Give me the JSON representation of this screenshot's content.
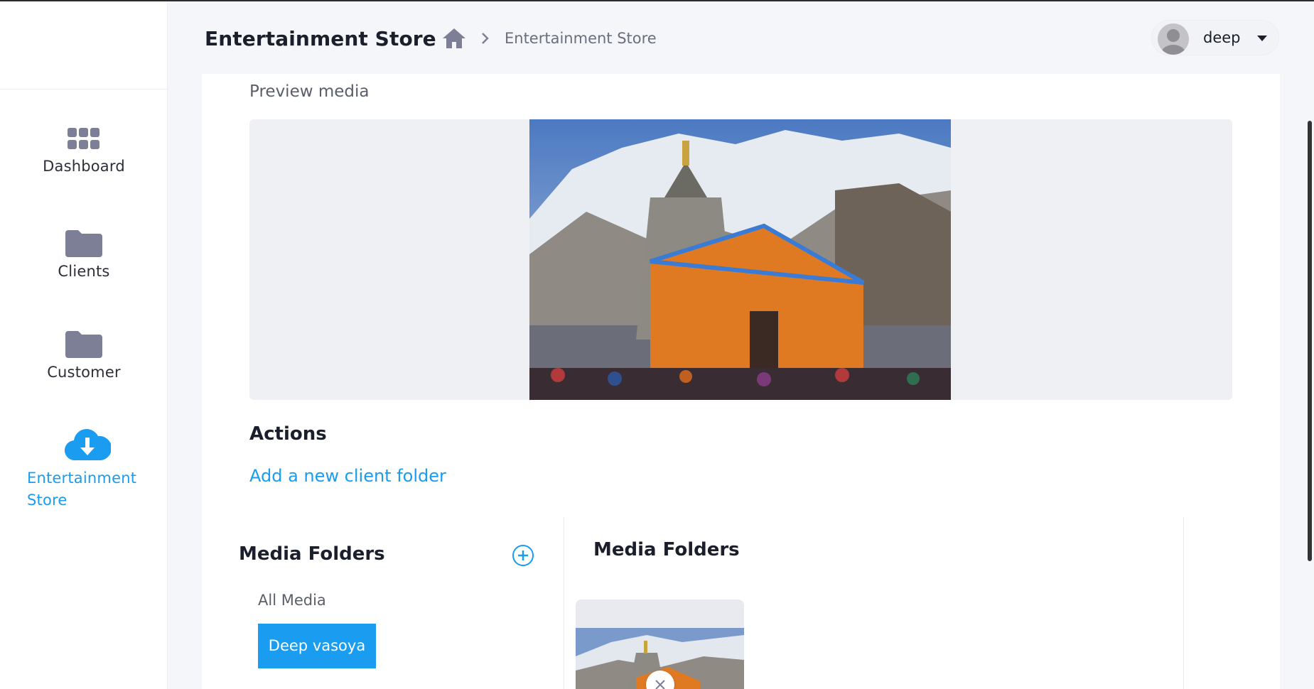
{
  "header": {
    "title": "Entertainment Store",
    "breadcrumb_current": "Entertainment Store",
    "user_name": "deep"
  },
  "sidebar": {
    "items": [
      {
        "label": "Dashboard",
        "icon": "grid-icon"
      },
      {
        "label": "Clients",
        "icon": "folder-icon"
      },
      {
        "label": "Customer",
        "icon": "folder-icon"
      },
      {
        "label": "Entertainment Store",
        "icon": "cloud-download-icon",
        "active": true
      }
    ]
  },
  "main": {
    "preview_label": "Preview media",
    "actions_title": "Actions",
    "add_folder_link": "Add a new client folder",
    "folders_left_title": "Media Folders",
    "all_media": "All Media",
    "folder_chip": "Deep vasoya",
    "folders_right_title": "Media Folders"
  },
  "colors": {
    "accent": "#1a9cf0",
    "icon_gray": "#7c7f96",
    "background": "#f4f6f9"
  }
}
